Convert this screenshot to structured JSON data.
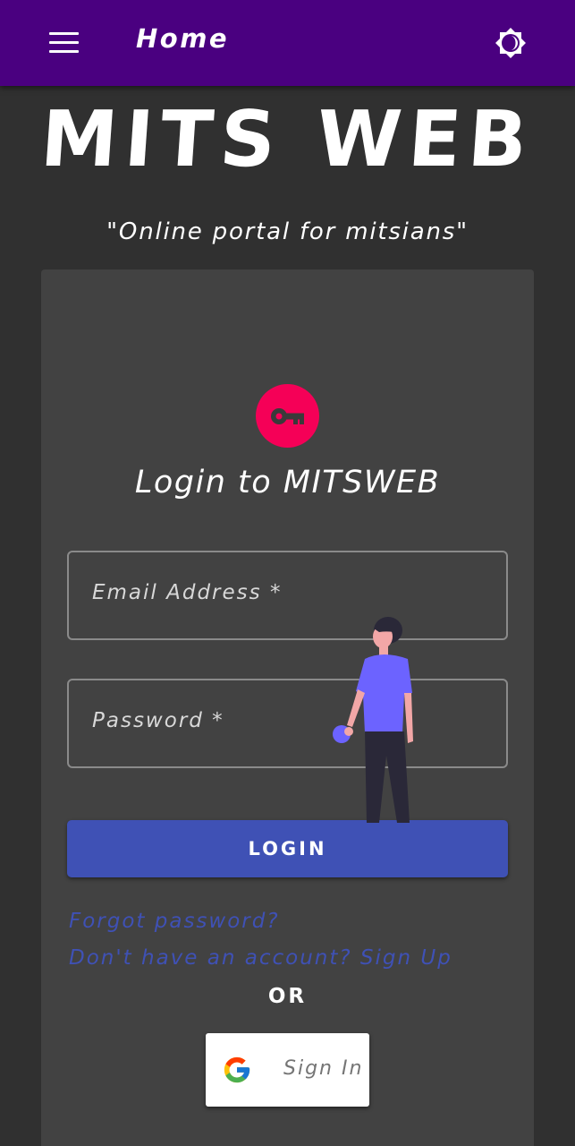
{
  "appbar": {
    "title": "Home",
    "menu_icon": "menu-icon",
    "theme_icon": "brightness-toggle-icon",
    "color": "#4a0080"
  },
  "brand": {
    "title": "MITS WEB",
    "tagline": "\"Online portal for mitsians\""
  },
  "login_card": {
    "icon": "key-icon",
    "icon_color": "#f50057",
    "title": "Login to MITSWEB",
    "email_label": "Email Address *",
    "password_label": "Password *",
    "login_button": "LOGIN",
    "forgot_link": "Forgot password?",
    "signup_link": "Don't have an account? Sign Up",
    "or_text": "OR",
    "google_button": "Sign In",
    "google_icon": "google-icon",
    "primary_color": "#3f51b5"
  }
}
